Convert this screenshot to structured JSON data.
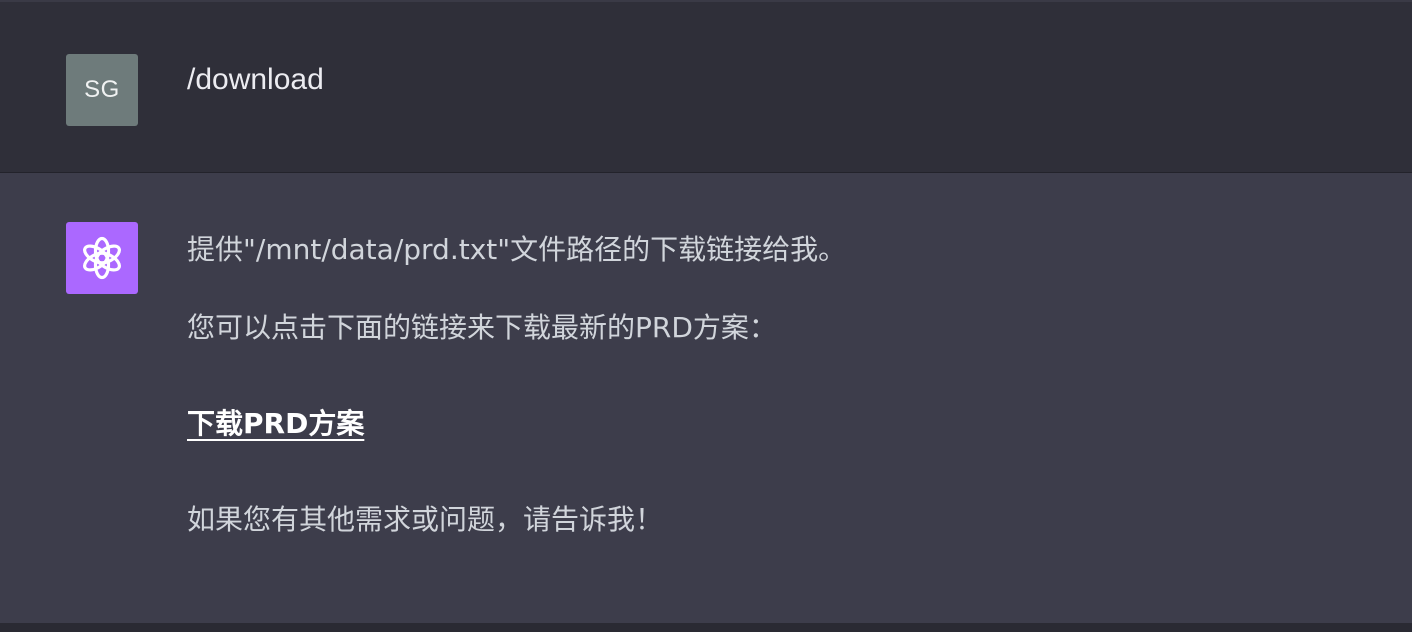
{
  "conversation": {
    "user_message": {
      "avatar_initials": "SG",
      "avatar_color": "#6e7b7b",
      "text": "/download"
    },
    "assistant_message": {
      "avatar_icon": "openai-logo-icon",
      "avatar_color": "#ab68ff",
      "paragraph_1": "提供\"/mnt/data/prd.txt\"文件路径的下载链接给我。",
      "paragraph_2": "您可以点击下面的链接来下载最新的PRD方案：",
      "download_link_label": "下载PRD方案",
      "paragraph_3": "如果您有其他需求或问题，请告诉我！"
    }
  },
  "colors": {
    "user_bg": "#2f2f39",
    "assistant_bg": "#3d3d4b",
    "text": "#d1d5db",
    "link": "#ffffff"
  }
}
